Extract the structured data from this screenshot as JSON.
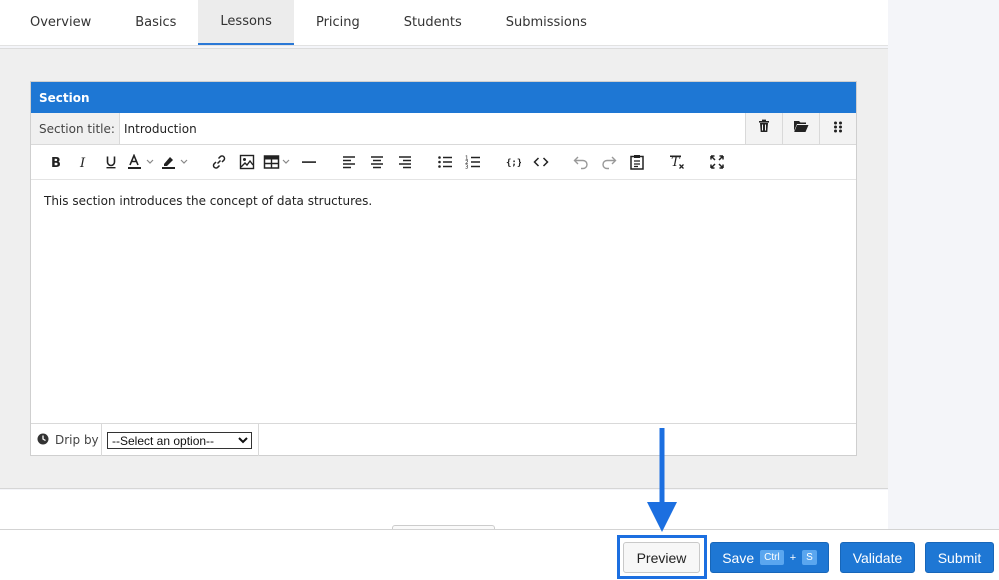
{
  "tabs": [
    {
      "label": "Overview"
    },
    {
      "label": "Basics"
    },
    {
      "label": "Lessons"
    },
    {
      "label": "Pricing"
    },
    {
      "label": "Students"
    },
    {
      "label": "Submissions"
    }
  ],
  "active_tab": "Lessons",
  "section": {
    "header": "Section",
    "title_label": "Section title:",
    "title_value": "Introduction",
    "content": "This section introduces the concept of data structures.",
    "drip_label": "Drip by",
    "drip_selected": "--Select an option--"
  },
  "footer": {
    "preview_label": "Preview",
    "save_label": "Save",
    "save_key1": "Ctrl",
    "save_plus": "+",
    "save_key2": "S",
    "validate_label": "Validate",
    "submit_label": "Submit"
  },
  "colors": {
    "accent": "#1e77d4",
    "highlight": "#1c6fe0"
  }
}
